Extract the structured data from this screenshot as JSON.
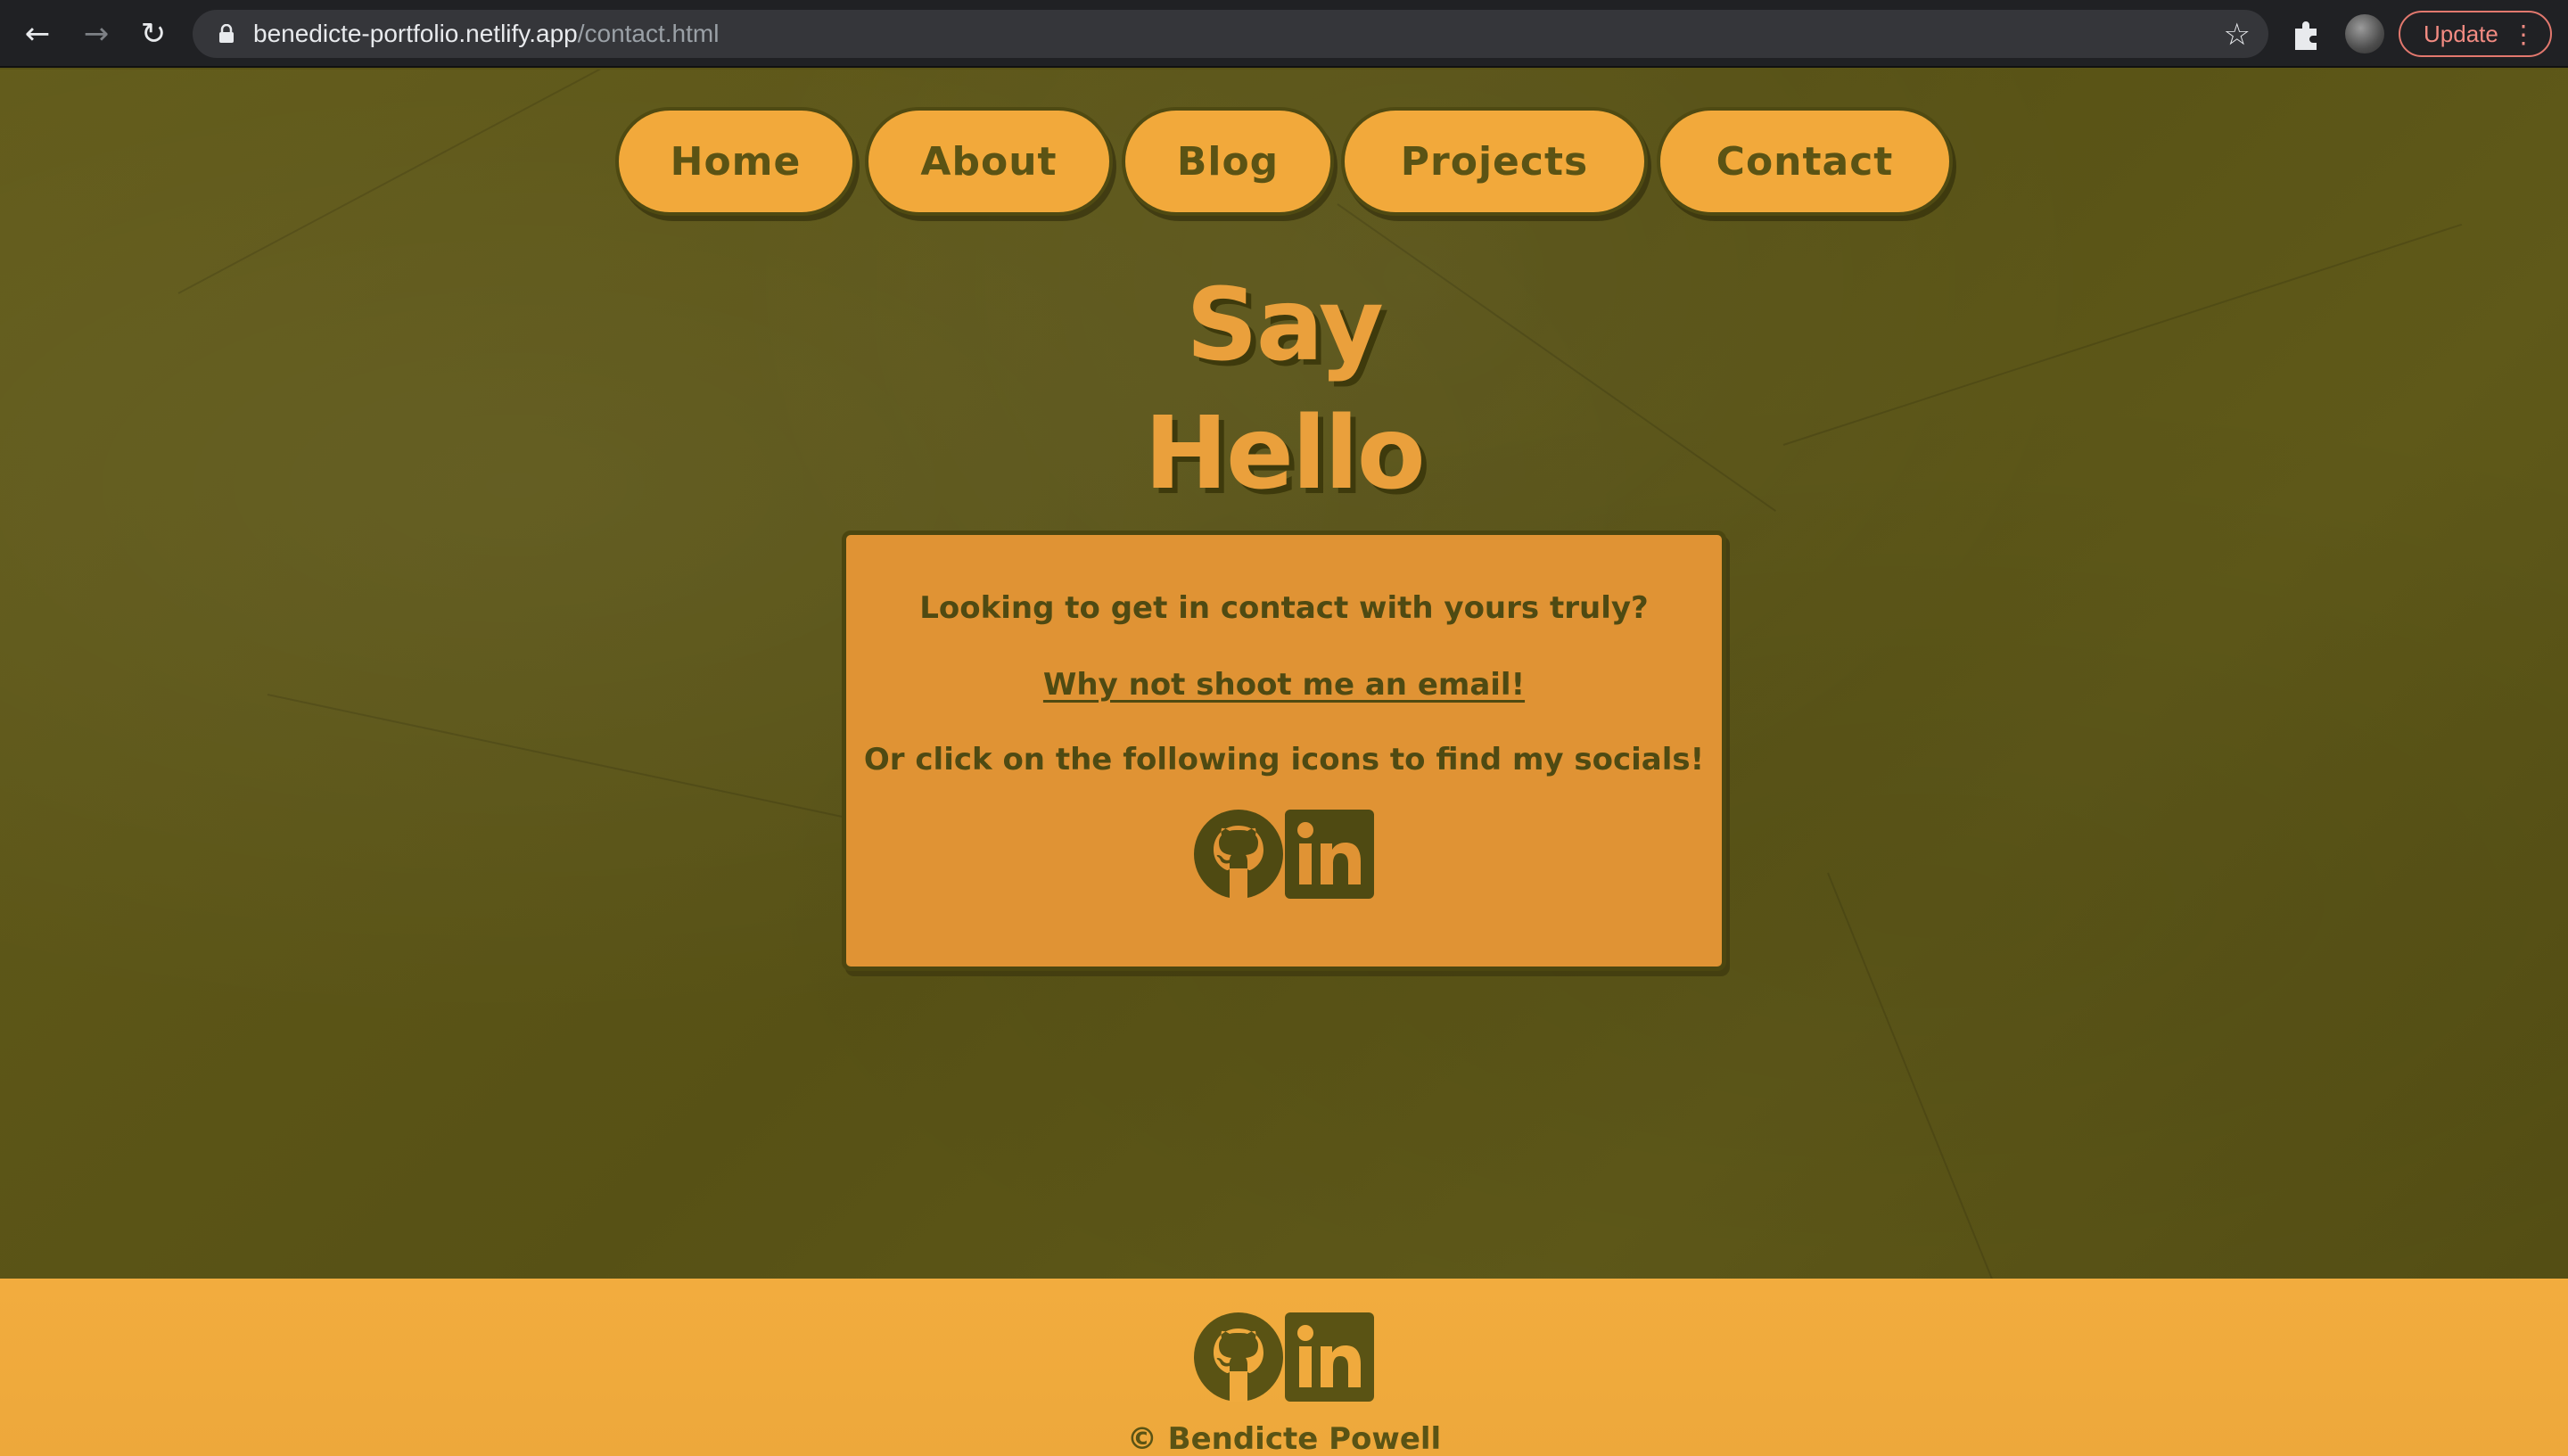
{
  "browser": {
    "url_host": "benedicte-portfolio.netlify.app",
    "url_path": "/contact.html",
    "update_label": "Update"
  },
  "nav": {
    "items": [
      {
        "label": "Home"
      },
      {
        "label": "About"
      },
      {
        "label": "Blog"
      },
      {
        "label": "Projects"
      },
      {
        "label": "Contact"
      }
    ]
  },
  "hero": {
    "line1": "Say",
    "line2": "Hello"
  },
  "card": {
    "question": "Looking to get in contact with yours truly?",
    "email_link": "Why not shoot me an email!",
    "socials_text": "Or click on the following icons to find my socials!"
  },
  "footer": {
    "copyright": "© Bendicte Powell"
  },
  "colors": {
    "background": "#5a5416",
    "accent": "#f2a93b",
    "card": "#e09334",
    "text_dark": "#4f4a12"
  }
}
